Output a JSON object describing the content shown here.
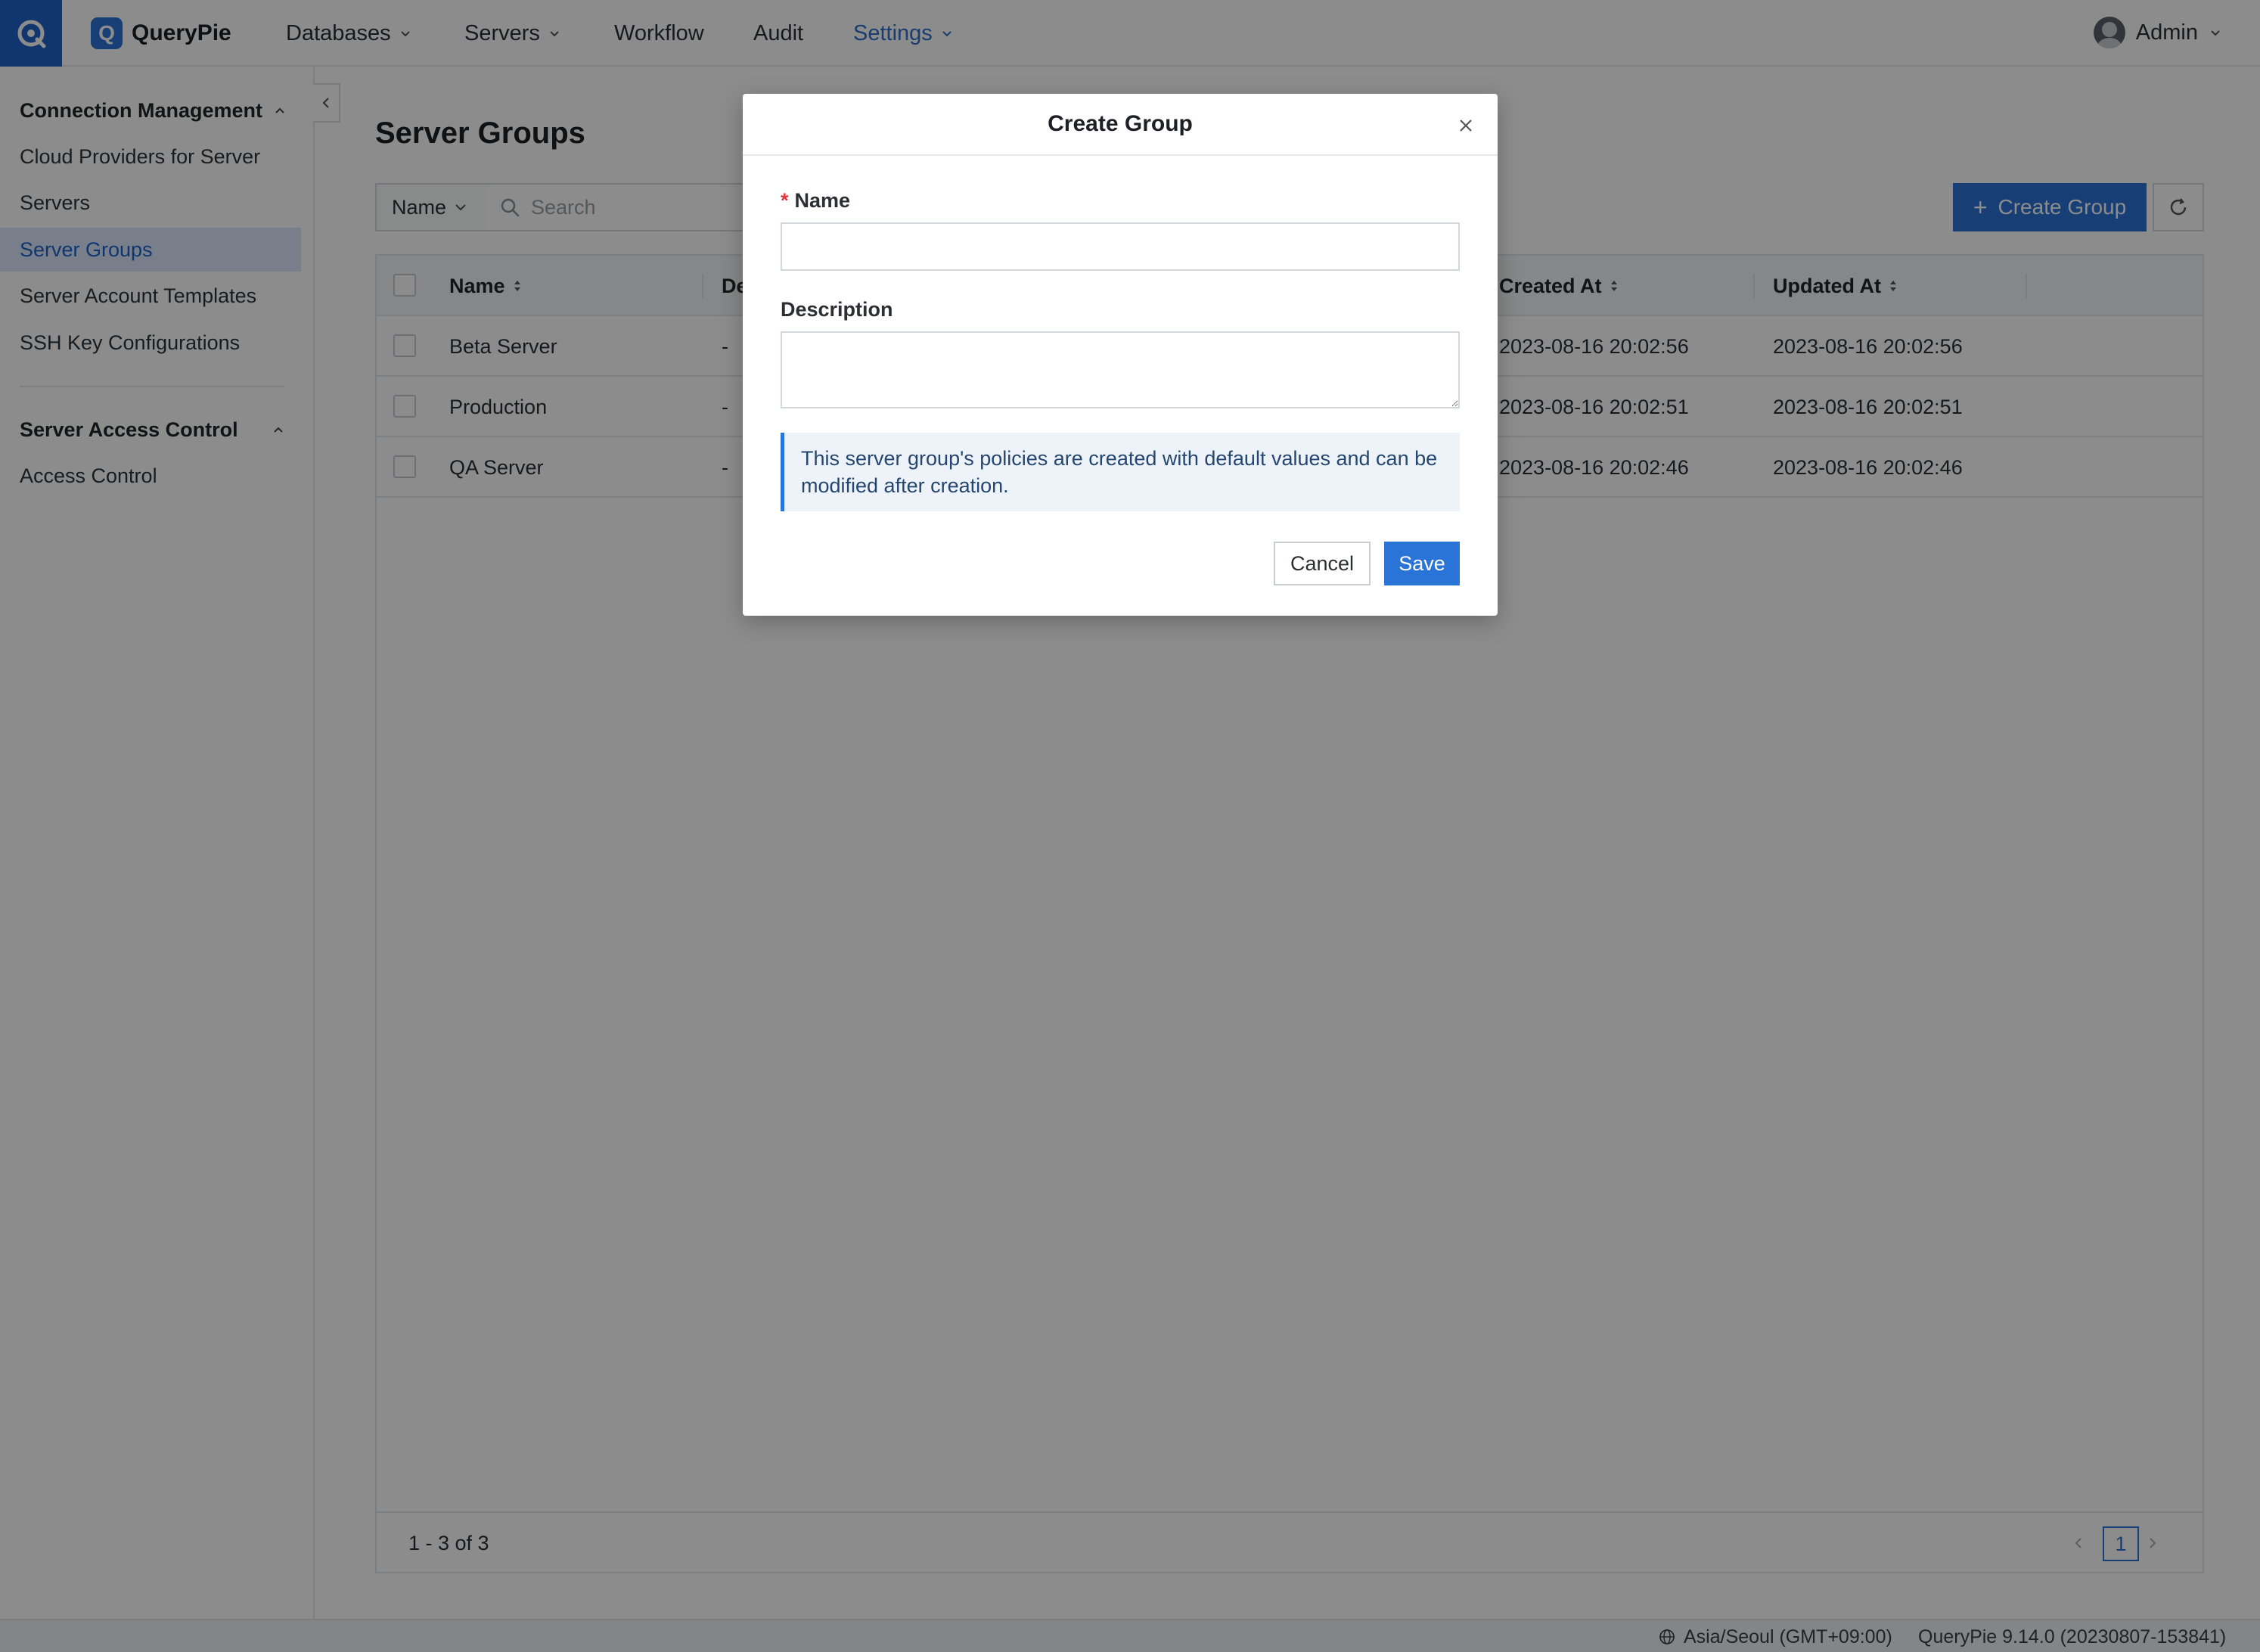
{
  "topbar": {
    "app_name": "QueryPie",
    "logo_letter": "Q",
    "nav": [
      {
        "label": "Databases",
        "has_dropdown": true
      },
      {
        "label": "Servers",
        "has_dropdown": true
      },
      {
        "label": "Workflow",
        "has_dropdown": false
      },
      {
        "label": "Audit",
        "has_dropdown": false
      },
      {
        "label": "Settings",
        "has_dropdown": true,
        "active": true
      }
    ],
    "user": "Admin"
  },
  "sidebar": {
    "sections": [
      {
        "title": "Connection Management",
        "items": [
          {
            "label": "Cloud Providers for Server"
          },
          {
            "label": "Servers"
          },
          {
            "label": "Server Groups",
            "selected": true
          },
          {
            "label": "Server Account Templates"
          },
          {
            "label": "SSH Key Configurations"
          }
        ]
      },
      {
        "title": "Server Access Control",
        "items": [
          {
            "label": "Access Control"
          }
        ]
      }
    ]
  },
  "main": {
    "title": "Server Groups",
    "filter": {
      "selected": "Name"
    },
    "search": {
      "placeholder": "Search",
      "value": ""
    },
    "create_button": "Create Group",
    "table": {
      "columns": [
        "Name",
        "De",
        "Created At",
        "Updated At"
      ],
      "rows": [
        {
          "name": "Beta Server",
          "description": "-",
          "created_at": "2023-08-16 20:02:56",
          "updated_at": "2023-08-16 20:02:56"
        },
        {
          "name": "Production",
          "description": "-",
          "created_at": "2023-08-16 20:02:51",
          "updated_at": "2023-08-16 20:02:51"
        },
        {
          "name": "QA Server",
          "description": "-",
          "created_at": "2023-08-16 20:02:46",
          "updated_at": "2023-08-16 20:02:46"
        }
      ]
    },
    "pagination": {
      "summary": "1 - 3 of 3",
      "current_page": "1"
    }
  },
  "modal": {
    "title": "Create Group",
    "name_label": "Name",
    "required_mark": "*",
    "name_value": "",
    "description_label": "Description",
    "description_value": "",
    "info": "This server group's policies are created with default values and can be modified after creation.",
    "cancel_label": "Cancel",
    "save_label": "Save"
  },
  "statusbar": {
    "timezone": "Asia/Seoul (GMT+09:00)",
    "version": "QueryPie 9.14.0 (20230807-153841)"
  },
  "colors": {
    "accent": "#2a74d8",
    "brand_block": "#1f63c7",
    "selected_bg": "#dbe8fb",
    "overlay": "rgba(0,0,0,0.45)"
  }
}
